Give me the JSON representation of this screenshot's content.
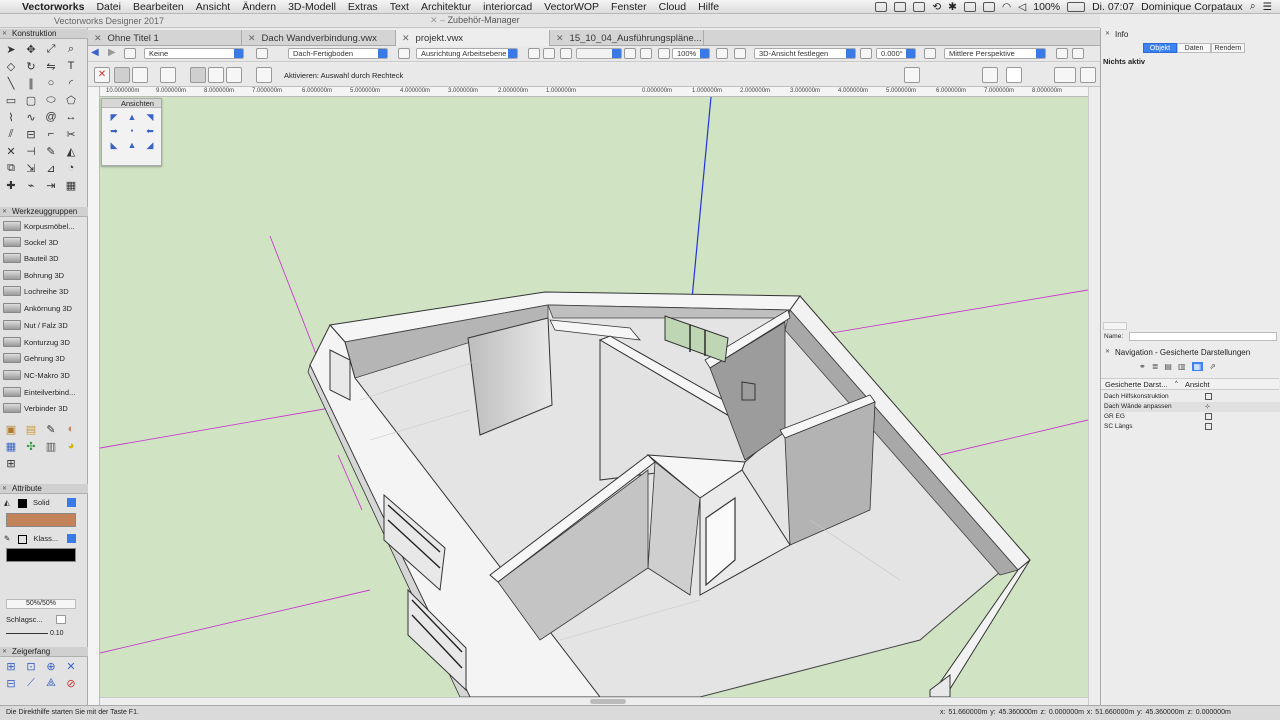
{
  "menubar": {
    "apple": "",
    "items": [
      "Vectorworks",
      "Datei",
      "Bearbeiten",
      "Ansicht",
      "Ändern",
      "3D-Modell",
      "Extras",
      "Text",
      "Architektur",
      "interiorcad",
      "VectorWOP",
      "Fenster",
      "Cloud",
      "Hilfe"
    ],
    "battery": "100%",
    "clock": "Di. 07:07",
    "user": "Dominique Corpataux"
  },
  "window": {
    "app_title": "Vectorworks Designer 2017",
    "zubehoer": "Zubehör-Manager",
    "tabs": [
      {
        "label": "Ohne Titel 1",
        "active": false
      },
      {
        "label": "Dach Wandverbindung.vwx",
        "active": false
      },
      {
        "label": "projekt.vwx",
        "active": true
      },
      {
        "label": "15_10_04_Ausführungspläne...",
        "active": false
      }
    ]
  },
  "toolbar1": {
    "klasse": "Keine",
    "ebene": "Dach-Fertigboden",
    "ausrichtung": "Ausrichtung Arbeitsebene",
    "zoom": "100%",
    "ansicht3d": "3D-Ansicht festlegen",
    "rotation": "0.000°",
    "perspektive": "Mittlere Perspektive"
  },
  "toolbar2": {
    "message": "Aktivieren: Auswahl durch Rechteck"
  },
  "ruler": {
    "ticks": [
      "10.000000m",
      "9.000000m",
      "8.000000m",
      "7.000000m",
      "6.000000m",
      "5.000000m",
      "4.000000m",
      "3.000000m",
      "2.000000m",
      "1.000000m",
      "0.000000m",
      "1.000000m",
      "2.000000m",
      "3.000000m",
      "4.000000m",
      "5.000000m",
      "6.000000m",
      "7.000000m",
      "8.000000m"
    ]
  },
  "left_palette": {
    "konstruktion": "Konstruktion",
    "werkzeuggruppen": "Werkzeuggruppen",
    "tools3d": [
      "Korpusmöbel...",
      "Sockel 3D",
      "Bauteil 3D",
      "Bohrung 3D",
      "Lochreihe 3D",
      "Ankörnung 3D",
      "Nut / Falz 3D",
      "Konturzug 3D",
      "Gehrung 3D",
      "NC-Makro 3D",
      "Einteilverbind...",
      "Verbinder 3D"
    ],
    "attribute": "Attribute",
    "fill_style": "Solid",
    "fill_color": "#c2835a",
    "pen_style": "Klass...",
    "opacity": "50%/50%",
    "schlagschatten": "Schlagsc...",
    "line_width": "0.10",
    "zeigerfang": "Zeigerfang"
  },
  "ansichten": {
    "title": "Ansichten"
  },
  "status_bar": {
    "hint": "Die Direkthilfe starten Sie mit der Taste F1.",
    "coords": "x: 51.660000m   y: 45.360000m   z: 0.000000m   x: 51.660000m   y: 45.360000m   z: 0.000000m"
  },
  "info_panel": {
    "title": "Info",
    "tabs": [
      "Objekt",
      "Daten",
      "Rendern"
    ],
    "active_tab": "Objekt",
    "status": "Nichts aktiv",
    "name_label": "Name:"
  },
  "navigation": {
    "title": "Navigation - Gesicherte Darstellungen",
    "col1": "Gesicherte Darst...",
    "col2": "Ansicht",
    "rows": [
      "Dach Hilfskonstruktion",
      "Dach Wände anpassen",
      "GR EG",
      "SC Längs"
    ]
  },
  "colors": {
    "canvas_bg": "#d0e4c4",
    "accent": "#3d82f0",
    "axis_magenta": "#c83ccb",
    "axis_blue": "#2233dd"
  }
}
